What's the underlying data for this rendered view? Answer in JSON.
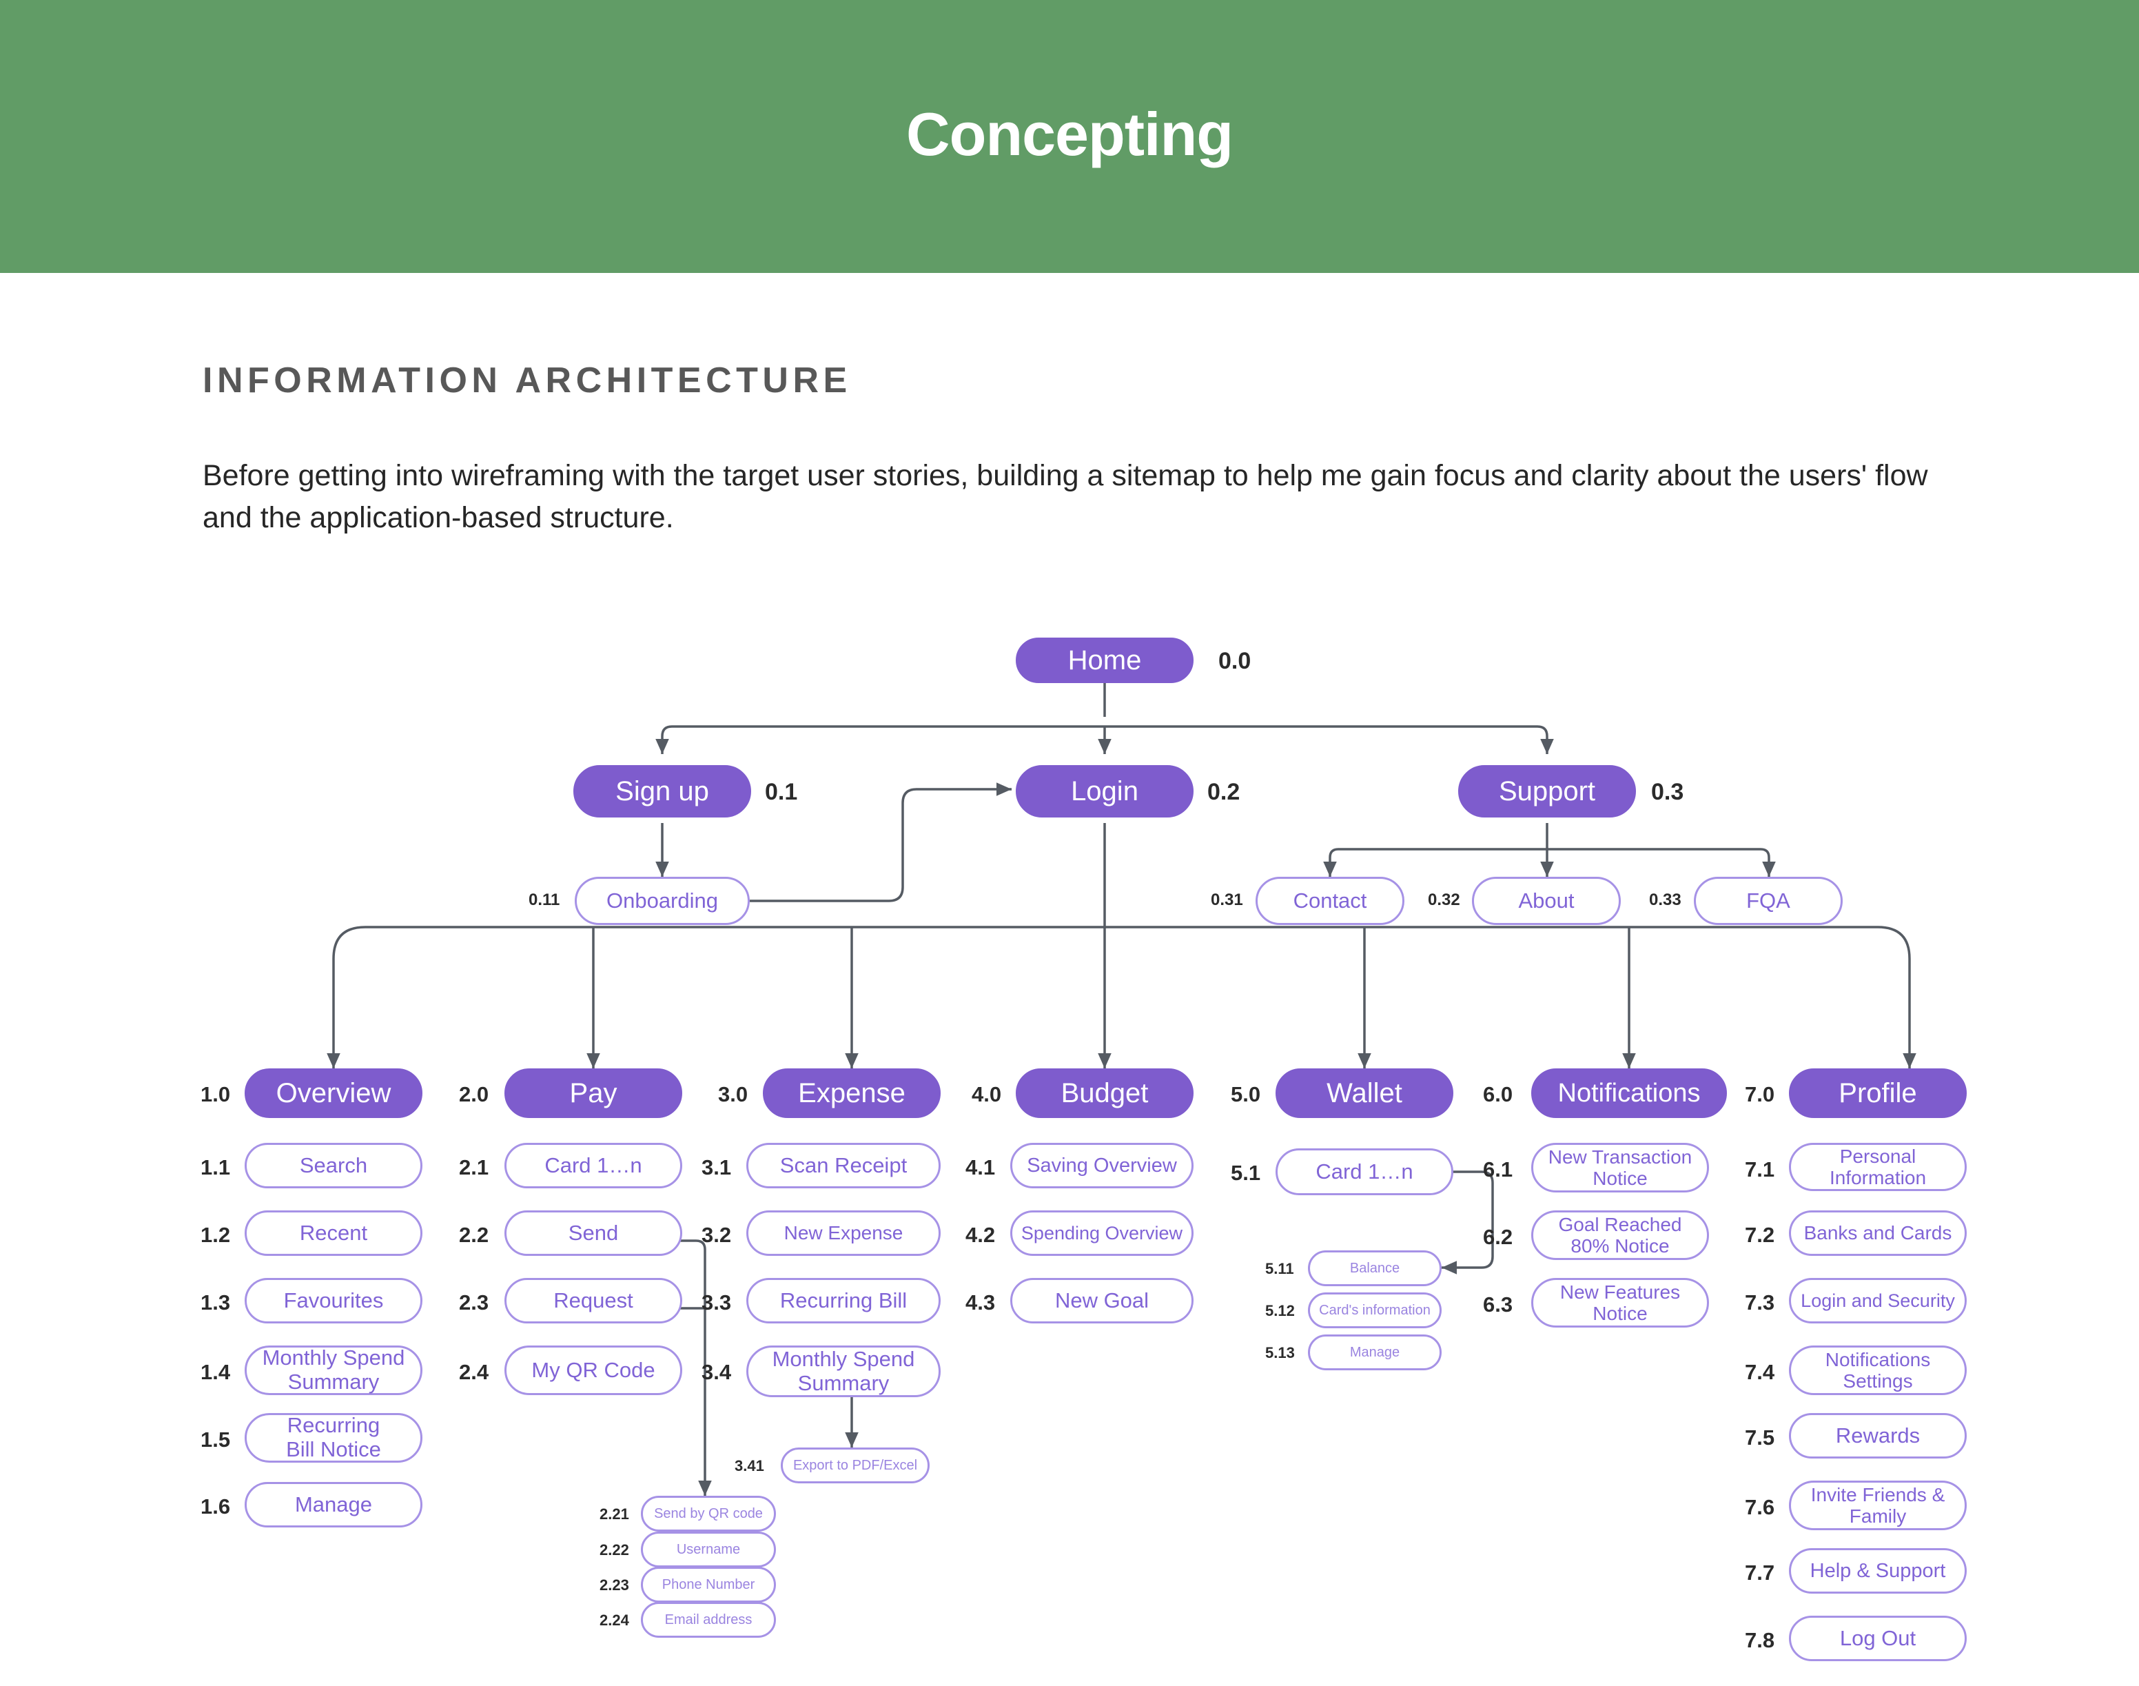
{
  "header": {
    "title": "Concepting",
    "bg_color": "#619C66"
  },
  "section": {
    "heading": "INFORMATION ARCHITECTURE",
    "paragraph": "Before getting into wireframing with the target user stories, building a sitemap to help me gain focus and clarity about the users' flow and the application-based structure."
  },
  "colors": {
    "primary_node": "#7E5CCD",
    "secondary_border": "#A692E6",
    "secondary_text": "#8064D6",
    "connector": "#555B63",
    "heading_text": "#585858"
  },
  "diagram": {
    "root": {
      "id": "0.0",
      "label": "Home"
    },
    "level1": [
      {
        "id": "0.1",
        "label": "Sign up"
      },
      {
        "id": "0.2",
        "label": "Login"
      },
      {
        "id": "0.3",
        "label": "Support"
      }
    ],
    "level1_children": [
      {
        "id": "0.11",
        "label": "Onboarding",
        "parent": "0.1"
      },
      {
        "id": "0.31",
        "label": "Contact",
        "parent": "0.3"
      },
      {
        "id": "0.32",
        "label": "About",
        "parent": "0.3"
      },
      {
        "id": "0.33",
        "label": "FQA",
        "parent": "0.3"
      }
    ],
    "columns": [
      {
        "id": "1.0",
        "label": "Overview",
        "children": [
          {
            "id": "1.1",
            "label": "Search"
          },
          {
            "id": "1.2",
            "label": "Recent"
          },
          {
            "id": "1.3",
            "label": "Favourites"
          },
          {
            "id": "1.4",
            "label": "Monthly Spend\nSummary"
          },
          {
            "id": "1.5",
            "label": "Recurring\nBill Notice"
          },
          {
            "id": "1.6",
            "label": "Manage"
          }
        ]
      },
      {
        "id": "2.0",
        "label": "Pay",
        "children": [
          {
            "id": "2.1",
            "label": "Card 1…n"
          },
          {
            "id": "2.2",
            "label": "Send"
          },
          {
            "id": "2.3",
            "label": "Request"
          },
          {
            "id": "2.4",
            "label": "My QR Code"
          }
        ],
        "grandchildren": [
          {
            "id": "2.21",
            "label": "Send by QR code"
          },
          {
            "id": "2.22",
            "label": "Username"
          },
          {
            "id": "2.23",
            "label": "Phone Number"
          },
          {
            "id": "2.24",
            "label": "Email address"
          }
        ]
      },
      {
        "id": "3.0",
        "label": "Expense",
        "children": [
          {
            "id": "3.1",
            "label": "Scan Receipt"
          },
          {
            "id": "3.2",
            "label": "New Expense"
          },
          {
            "id": "3.3",
            "label": "Recurring Bill"
          },
          {
            "id": "3.4",
            "label": "Monthly Spend\nSummary"
          }
        ],
        "grandchildren": [
          {
            "id": "3.41",
            "label": "Export to PDF/Excel"
          }
        ]
      },
      {
        "id": "4.0",
        "label": "Budget",
        "children": [
          {
            "id": "4.1",
            "label": "Saving Overview"
          },
          {
            "id": "4.2",
            "label": "Spending Overview"
          },
          {
            "id": "4.3",
            "label": "New Goal"
          }
        ]
      },
      {
        "id": "5.0",
        "label": "Wallet",
        "children": [
          {
            "id": "5.1",
            "label": "Card 1…n"
          }
        ],
        "grandchildren": [
          {
            "id": "5.11",
            "label": "Balance"
          },
          {
            "id": "5.12",
            "label": "Card's information"
          },
          {
            "id": "5.13",
            "label": "Manage"
          }
        ]
      },
      {
        "id": "6.0",
        "label": "Notifications",
        "children": [
          {
            "id": "6.1",
            "label": "New Transaction\nNotice"
          },
          {
            "id": "6.2",
            "label": "Goal Reached\n80% Notice"
          },
          {
            "id": "6.3",
            "label": "New Features\nNotice"
          }
        ]
      },
      {
        "id": "7.0",
        "label": "Profile",
        "children": [
          {
            "id": "7.1",
            "label": "Personal\nInformation"
          },
          {
            "id": "7.2",
            "label": "Banks and Cards"
          },
          {
            "id": "7.3",
            "label": "Login and Security"
          },
          {
            "id": "7.4",
            "label": "Notifications\nSettings"
          },
          {
            "id": "7.5",
            "label": "Rewards"
          },
          {
            "id": "7.6",
            "label": "Invite Friends &\nFamily"
          },
          {
            "id": "7.7",
            "label": "Help & Support"
          },
          {
            "id": "7.8",
            "label": "Log Out"
          }
        ]
      }
    ]
  }
}
